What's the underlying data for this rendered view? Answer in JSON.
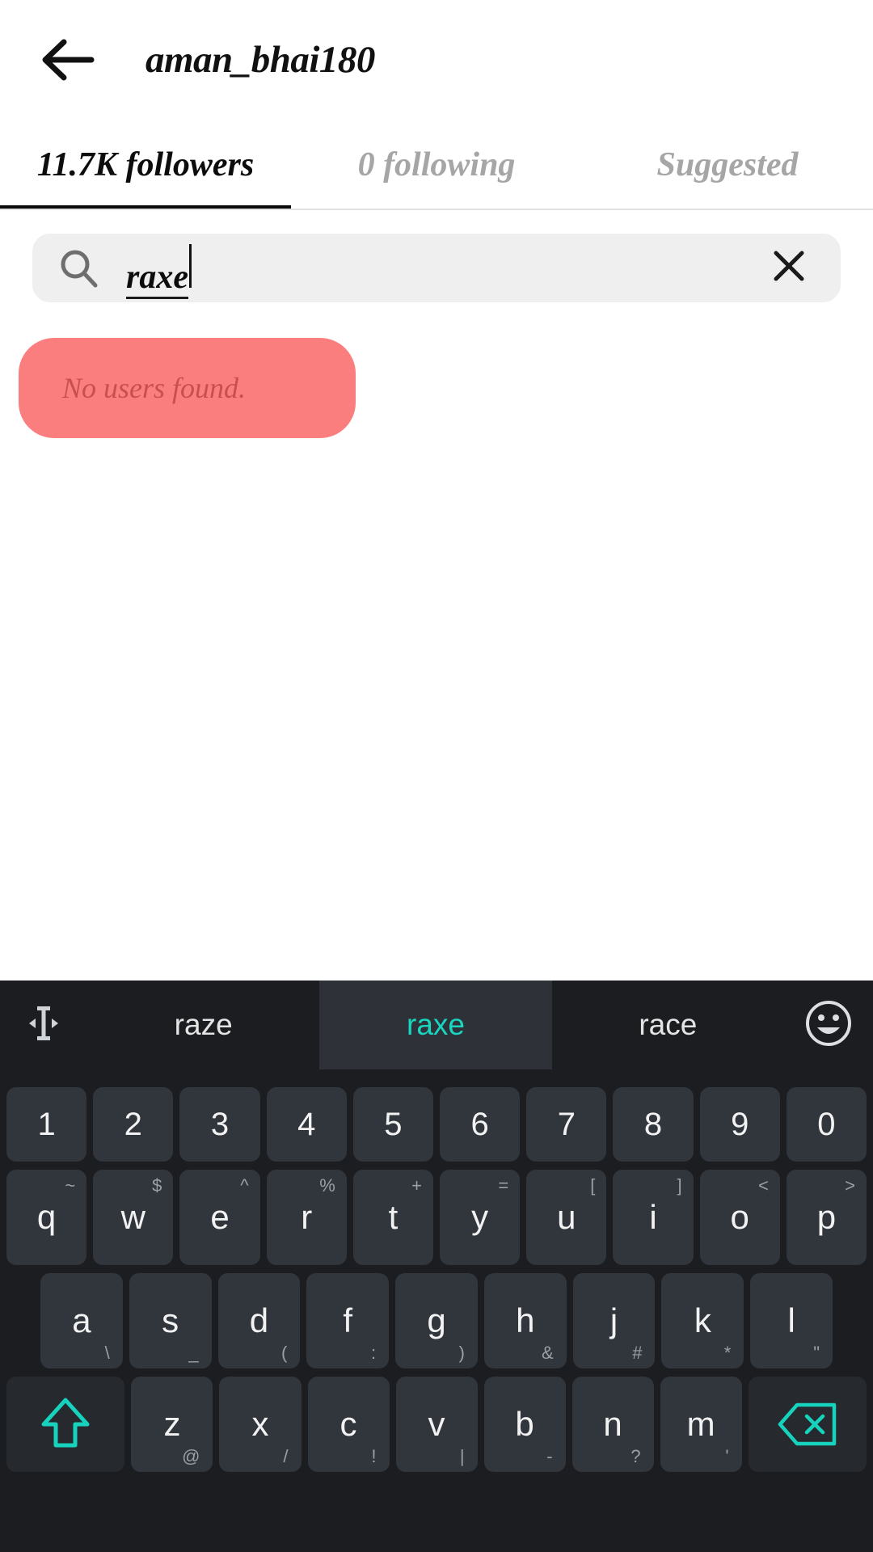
{
  "header": {
    "back_icon": "arrow-left-icon",
    "title": "aman_bhai180"
  },
  "tabs": [
    {
      "label": "11.7K followers",
      "active": true
    },
    {
      "label": "0 following",
      "active": false
    },
    {
      "label": "Suggested",
      "active": false
    }
  ],
  "search": {
    "icon": "search-icon",
    "value": "raxe",
    "placeholder": "Search",
    "clear_icon": "close-icon"
  },
  "result_message": {
    "text": "No users found.",
    "bg_color": "#fb7e7e",
    "text_color": "#c7504f"
  },
  "keyboard": {
    "accent_color": "#17d3bd",
    "background": "#1c1d20",
    "key_color": "#31353c",
    "suggestion_bar": {
      "left_icon": "text-cursor-move-icon",
      "right_icon": "emoji-smiley-icon",
      "suggestions": [
        {
          "label": "raze",
          "highlighted": false
        },
        {
          "label": "raxe",
          "highlighted": true
        },
        {
          "label": "race",
          "highlighted": false
        }
      ]
    },
    "rows": [
      {
        "name": "number-row",
        "keys": [
          {
            "main": "1"
          },
          {
            "main": "2"
          },
          {
            "main": "3"
          },
          {
            "main": "4"
          },
          {
            "main": "5"
          },
          {
            "main": "6"
          },
          {
            "main": "7"
          },
          {
            "main": "8"
          },
          {
            "main": "9"
          },
          {
            "main": "0"
          }
        ]
      },
      {
        "name": "qwerty-row",
        "keys": [
          {
            "main": "q",
            "sub_tr": "~"
          },
          {
            "main": "w",
            "sub_tr": "$"
          },
          {
            "main": "e",
            "sub_tr": "^"
          },
          {
            "main": "r",
            "sub_tr": "%"
          },
          {
            "main": "t",
            "sub_tr": "+"
          },
          {
            "main": "y",
            "sub_tr": "="
          },
          {
            "main": "u",
            "sub_tr": "["
          },
          {
            "main": "i",
            "sub_tr": "]"
          },
          {
            "main": "o",
            "sub_tr": "<"
          },
          {
            "main": "p",
            "sub_tr": ">"
          }
        ]
      },
      {
        "name": "home-row",
        "keys": [
          {
            "main": "a",
            "sub_br": "\\"
          },
          {
            "main": "s",
            "sub_br": "_"
          },
          {
            "main": "d",
            "sub_br": "("
          },
          {
            "main": "f",
            "sub_br": ":"
          },
          {
            "main": "g",
            "sub_br": ")"
          },
          {
            "main": "h",
            "sub_br": "&"
          },
          {
            "main": "j",
            "sub_br": "#"
          },
          {
            "main": "k",
            "sub_br": "*"
          },
          {
            "main": "l",
            "sub_br": "\""
          }
        ]
      },
      {
        "name": "bottom-row",
        "keys": [
          {
            "main": "",
            "icon": "shift-icon",
            "func": true
          },
          {
            "main": "z",
            "sub_br": "@"
          },
          {
            "main": "x",
            "sub_br": "/"
          },
          {
            "main": "c",
            "sub_br": "!"
          },
          {
            "main": "v",
            "sub_br": "|"
          },
          {
            "main": "b",
            "sub_br": "-"
          },
          {
            "main": "n",
            "sub_br": "?"
          },
          {
            "main": "m",
            "sub_br": "'"
          },
          {
            "main": "",
            "icon": "backspace-icon",
            "func": true
          }
        ]
      }
    ]
  }
}
